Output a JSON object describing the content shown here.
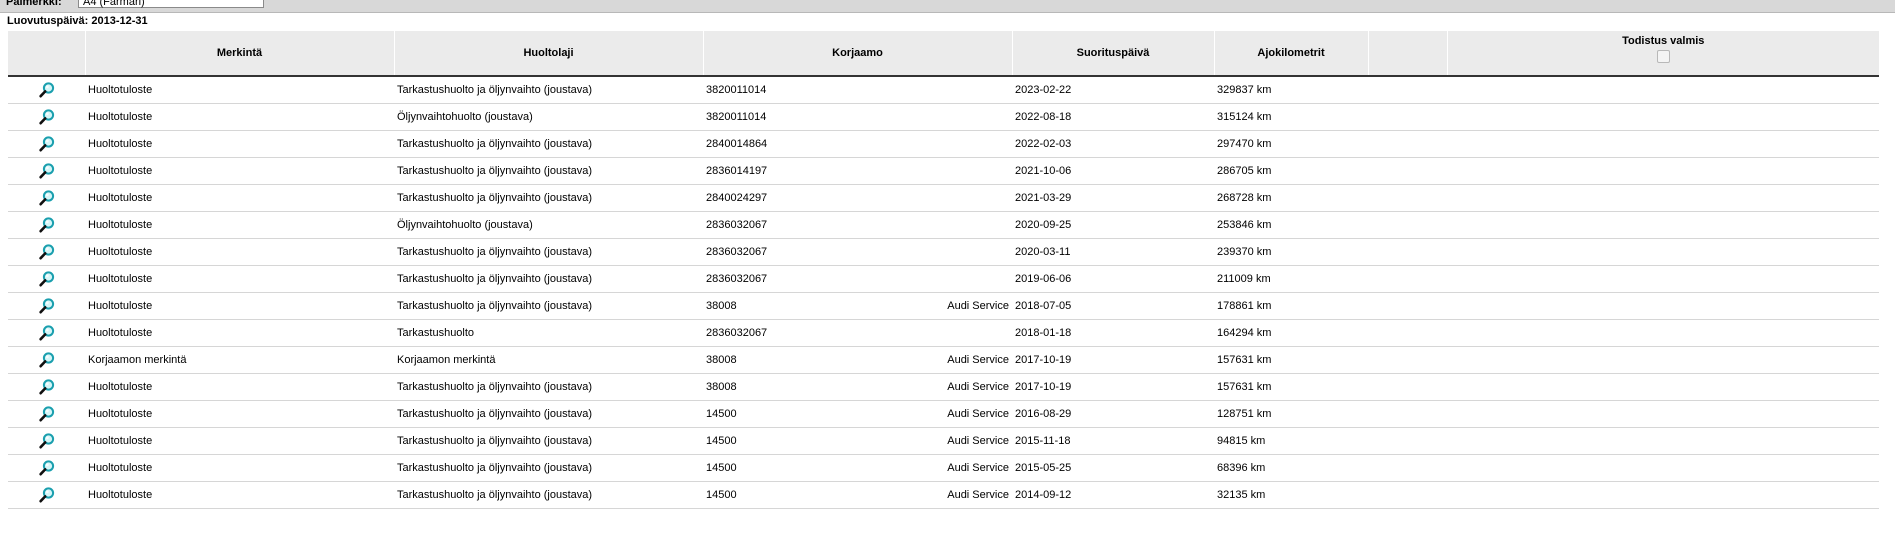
{
  "topbar": {
    "label": "Palmerkki:",
    "select_value": "A4 (Farmari)"
  },
  "delivery": {
    "label": "Luovutuspäivä: 2013-12-31"
  },
  "table": {
    "headers": {
      "view": "",
      "merkinta": "Merkintä",
      "huoltolaji": "Huoltolaji",
      "korjaamo": "Korjaamo",
      "suorituspaiva": "Suorituspäivä",
      "ajokilometrit": "Ajokilometrit",
      "extra": "",
      "todistus": "Todistus valmis"
    },
    "rows": [
      {
        "merkinta": "Huoltotuloste",
        "huoltolaji": "Tarkastushuolto ja öljynvaihto (joustava)",
        "korjaamo_nro": "3820011014",
        "korjaamo_nimi": "",
        "pvm": "2023-02-22",
        "km": "329837 km"
      },
      {
        "merkinta": "Huoltotuloste",
        "huoltolaji": "Öljynvaihtohuolto (joustava)",
        "korjaamo_nro": "3820011014",
        "korjaamo_nimi": "",
        "pvm": "2022-08-18",
        "km": "315124 km"
      },
      {
        "merkinta": "Huoltotuloste",
        "huoltolaji": "Tarkastushuolto ja öljynvaihto (joustava)",
        "korjaamo_nro": "2840014864",
        "korjaamo_nimi": "",
        "pvm": "2022-02-03",
        "km": "297470 km"
      },
      {
        "merkinta": "Huoltotuloste",
        "huoltolaji": "Tarkastushuolto ja öljynvaihto (joustava)",
        "korjaamo_nro": "2836014197",
        "korjaamo_nimi": "",
        "pvm": "2021-10-06",
        "km": "286705 km"
      },
      {
        "merkinta": "Huoltotuloste",
        "huoltolaji": "Tarkastushuolto ja öljynvaihto (joustava)",
        "korjaamo_nro": "2840024297",
        "korjaamo_nimi": "",
        "pvm": "2021-03-29",
        "km": "268728 km"
      },
      {
        "merkinta": "Huoltotuloste",
        "huoltolaji": "Öljynvaihtohuolto (joustava)",
        "korjaamo_nro": "2836032067",
        "korjaamo_nimi": "",
        "pvm": "2020-09-25",
        "km": "253846 km"
      },
      {
        "merkinta": "Huoltotuloste",
        "huoltolaji": "Tarkastushuolto ja öljynvaihto (joustava)",
        "korjaamo_nro": "2836032067",
        "korjaamo_nimi": "",
        "pvm": "2020-03-11",
        "km": "239370 km"
      },
      {
        "merkinta": "Huoltotuloste",
        "huoltolaji": "Tarkastushuolto ja öljynvaihto (joustava)",
        "korjaamo_nro": "2836032067",
        "korjaamo_nimi": "",
        "pvm": "2019-06-06",
        "km": "211009 km"
      },
      {
        "merkinta": "Huoltotuloste",
        "huoltolaji": "Tarkastushuolto ja öljynvaihto (joustava)",
        "korjaamo_nro": "38008",
        "korjaamo_nimi": "Audi Service",
        "pvm": "2018-07-05",
        "km": "178861 km"
      },
      {
        "merkinta": "Huoltotuloste",
        "huoltolaji": "Tarkastushuolto",
        "korjaamo_nro": "2836032067",
        "korjaamo_nimi": "",
        "pvm": "2018-01-18",
        "km": "164294 km"
      },
      {
        "merkinta": "Korjaamon merkintä",
        "huoltolaji": "Korjaamon merkintä",
        "korjaamo_nro": "38008",
        "korjaamo_nimi": "Audi Service",
        "pvm": "2017-10-19",
        "km": "157631 km"
      },
      {
        "merkinta": "Huoltotuloste",
        "huoltolaji": "Tarkastushuolto ja öljynvaihto (joustava)",
        "korjaamo_nro": "38008",
        "korjaamo_nimi": "Audi Service",
        "pvm": "2017-10-19",
        "km": "157631 km"
      },
      {
        "merkinta": "Huoltotuloste",
        "huoltolaji": "Tarkastushuolto ja öljynvaihto (joustava)",
        "korjaamo_nro": "14500",
        "korjaamo_nimi": "Audi Service",
        "pvm": "2016-08-29",
        "km": "128751 km"
      },
      {
        "merkinta": "Huoltotuloste",
        "huoltolaji": "Tarkastushuolto ja öljynvaihto (joustava)",
        "korjaamo_nro": "14500",
        "korjaamo_nimi": "Audi Service",
        "pvm": "2015-11-18",
        "km": "94815 km"
      },
      {
        "merkinta": "Huoltotuloste",
        "huoltolaji": "Tarkastushuolto ja öljynvaihto (joustava)",
        "korjaamo_nro": "14500",
        "korjaamo_nimi": "Audi Service",
        "pvm": "2015-05-25",
        "km": "68396 km"
      },
      {
        "merkinta": "Huoltotuloste",
        "huoltolaji": "Tarkastushuolto ja öljynvaihto (joustava)",
        "korjaamo_nro": "14500",
        "korjaamo_nimi": "Audi Service",
        "pvm": "2014-09-12",
        "km": "32135 km"
      }
    ]
  },
  "icons": {
    "view_row": "magnifier-icon",
    "certificate": "checkbox"
  },
  "colors": {
    "header_bg": "#ebebeb",
    "magnifier_lens": "#2ab7c4"
  }
}
